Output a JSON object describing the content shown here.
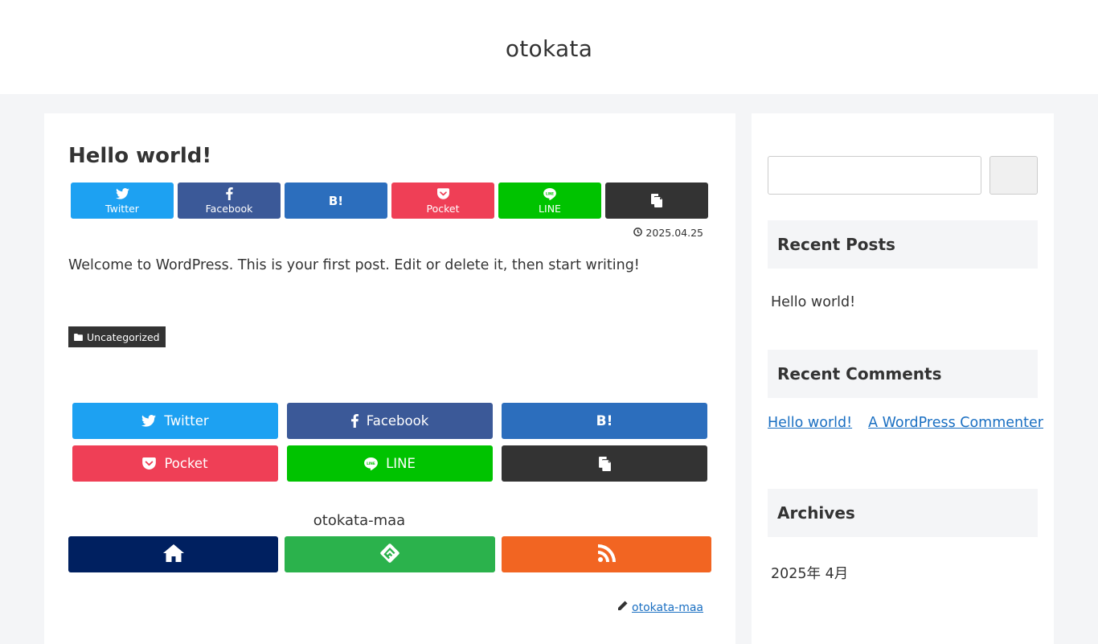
{
  "site": {
    "title": "otokata"
  },
  "post": {
    "title": "Hello world!",
    "date": "2025.04.25",
    "content": "Welcome to WordPress. This is your first post. Edit or delete it, then start writing!",
    "category": "Uncategorized"
  },
  "share_top": {
    "twitter": "Twitter",
    "facebook": "Facebook",
    "hatena": "B!",
    "pocket": "Pocket",
    "line": "LINE"
  },
  "share_bottom": {
    "twitter": "Twitter",
    "facebook": "Facebook",
    "hatena": "B!",
    "pocket": "Pocket",
    "line": "LINE"
  },
  "follow": {
    "title": "otokata-maa"
  },
  "author": {
    "name": "otokata-maa"
  },
  "sidebar": {
    "search": {
      "value": ""
    },
    "recent_posts": {
      "title": "Recent Posts",
      "items": [
        "Hello world!"
      ]
    },
    "recent_comments": {
      "title": "Recent Comments",
      "post_link": "Hello world!",
      "author_link": "A WordPress Commenter"
    },
    "archives": {
      "title": "Archives",
      "items": [
        "2025年 4月"
      ]
    }
  },
  "colors": {
    "twitter": "#1da1f2",
    "facebook": "#3b5998",
    "hatena": "#2c6ebd",
    "pocket": "#ef3f56",
    "line": "#00c300",
    "copy": "#333333",
    "home": "#002060",
    "feedly": "#2bb24c",
    "rss": "#f26522",
    "link": "#1a6fc2"
  },
  "icons": {
    "twitter": "twitter-icon",
    "facebook": "facebook-icon",
    "hatena": "hatena-icon",
    "pocket": "pocket-icon",
    "line": "line-icon",
    "copy": "copy-icon",
    "home": "home-icon",
    "feedly": "feedly-icon",
    "rss": "rss-icon",
    "date": "clock-icon",
    "category": "folder-icon",
    "author": "pencil-icon"
  }
}
